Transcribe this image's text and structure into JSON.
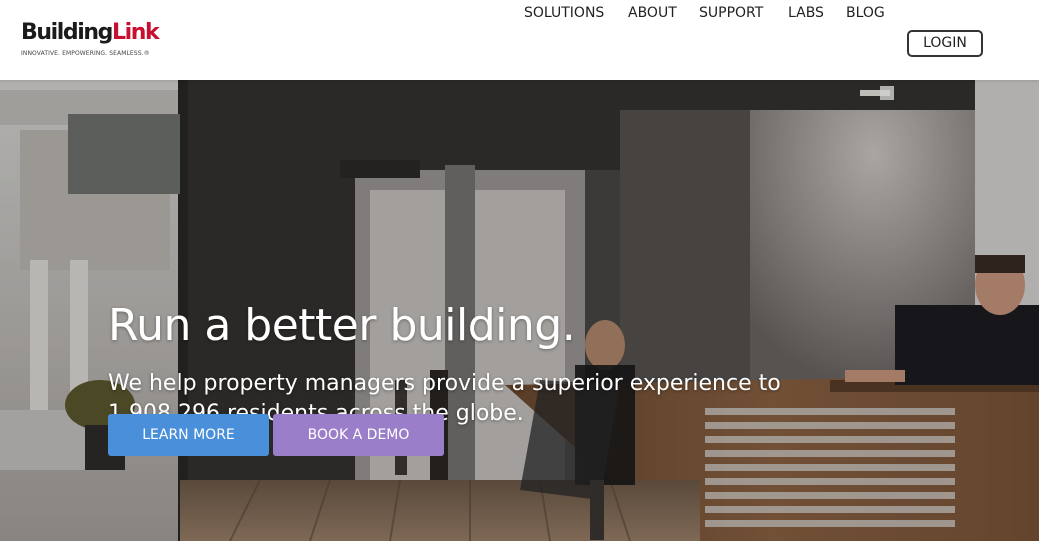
{
  "brand": {
    "name_part1": "Building",
    "name_part2": "Link",
    "tagline": "INNOVATIVE. EMPOWERING. SEAMLESS.®",
    "colors": {
      "dark": "#1b1b1b",
      "red": "#c8102e"
    }
  },
  "nav": {
    "items": [
      "SOLUTIONS",
      "ABOUT",
      "SUPPORT",
      "LABS",
      "BLOG"
    ],
    "login_label": "LOGIN"
  },
  "hero": {
    "title": "Run a better building.",
    "subtitle_line1": "We help property managers provide a superior experience to",
    "subtitle_line2": "1,908,296 residents across the globe.",
    "learn_more_label": "LEARN MORE",
    "book_demo_label": "BOOK A DEMO",
    "colors": {
      "learn_more": "#4a8fd9",
      "book_demo": "#9b7ec9"
    }
  }
}
